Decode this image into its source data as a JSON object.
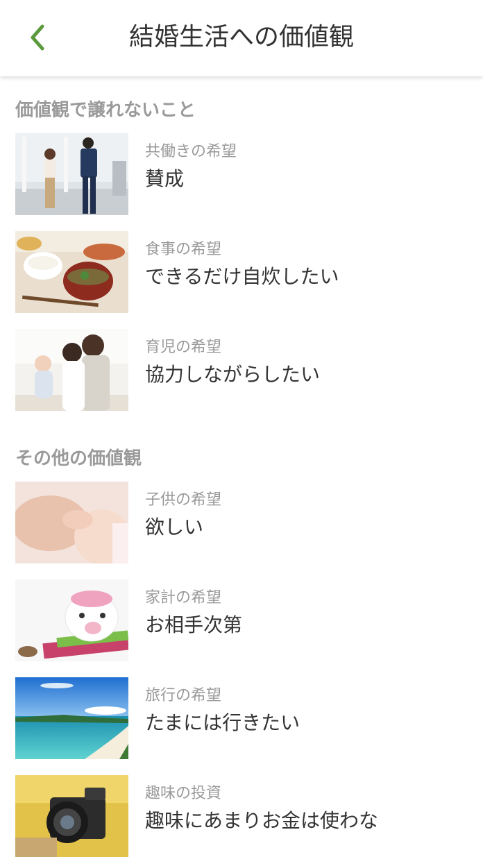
{
  "header": {
    "title": "結婚生活への価値観",
    "back_icon": "chevron-left-icon",
    "accent_color": "#5a9a3c"
  },
  "sections": [
    {
      "heading": "価値観で譲れないこと",
      "items": [
        {
          "label": "共働きの希望",
          "value": "賛成",
          "image": "working-couple-photo"
        },
        {
          "label": "食事の希望",
          "value": "できるだけ自炊したい",
          "image": "japanese-meal-photo"
        },
        {
          "label": "育児の希望",
          "value": "協力しながらしたい",
          "image": "family-with-baby-photo"
        }
      ]
    },
    {
      "heading": "その他の価値観",
      "items": [
        {
          "label": "子供の希望",
          "value": "欲しい",
          "image": "baby-hand-photo"
        },
        {
          "label": "家計の希望",
          "value": "お相手次第",
          "image": "piggy-bank-photo"
        },
        {
          "label": "旅行の希望",
          "value": "たまには行きたい",
          "image": "beach-photo"
        },
        {
          "label": "趣味の投資",
          "value": "趣味にあまりお金は使わな",
          "image": "camera-photo"
        }
      ]
    }
  ]
}
